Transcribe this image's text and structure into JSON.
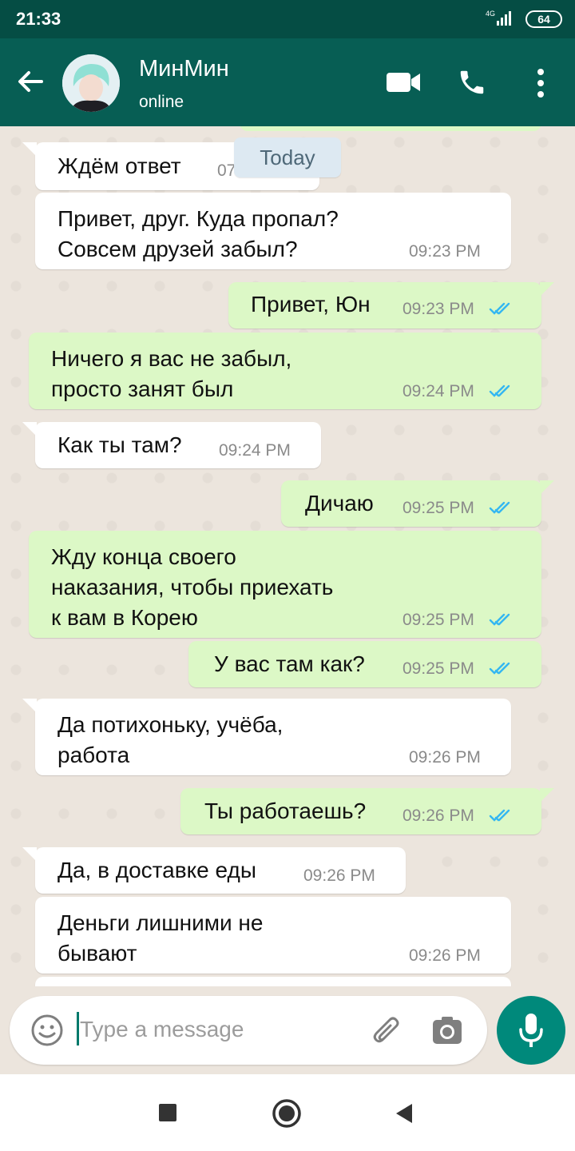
{
  "status_bar": {
    "time": "21:33",
    "network": "4G",
    "battery": "64"
  },
  "header": {
    "contact_name": "МинМин",
    "status": "online"
  },
  "date_divider": "Today",
  "messages": [
    {
      "dir": "in",
      "text": "Ждём ответ",
      "time": "07"
    },
    {
      "dir": "in",
      "text": "Привет, друг. Куда пропал?\nСовсем друзей забыл?",
      "time": "09:23 PM"
    },
    {
      "dir": "out",
      "text": "Привет, Юн",
      "time": "09:23 PM"
    },
    {
      "dir": "out",
      "text": "Ничего я вас не забыл,\nпросто занят был",
      "time": "09:24 PM"
    },
    {
      "dir": "in",
      "text": "Как ты там?",
      "time": "09:24 PM"
    },
    {
      "dir": "out",
      "text": "Дичаю",
      "time": "09:25 PM"
    },
    {
      "dir": "out",
      "text": "Жду конца своего\nнаказания, чтобы приехать\nк вам в Корею",
      "time": "09:25 PM"
    },
    {
      "dir": "out",
      "text": "У вас там как?",
      "time": "09:25 PM"
    },
    {
      "dir": "in",
      "text": "Да потихоньку, учёба,\nработа",
      "time": "09:26 PM"
    },
    {
      "dir": "out",
      "text": "Ты работаешь?",
      "time": "09:26 PM"
    },
    {
      "dir": "in",
      "text": "Да, в доставке еды",
      "time": "09:26 PM"
    },
    {
      "dir": "in",
      "text": "Деньги лишними не\nбывают",
      "time": "09:26 PM"
    }
  ],
  "composer": {
    "placeholder": "Type a message"
  },
  "colors": {
    "header": "#075e54",
    "incoming": "#ffffff",
    "outgoing": "#dcf8c6",
    "read_ticks": "#34b7f1",
    "fab": "#00897b"
  },
  "icons": [
    "back-arrow-icon",
    "video-call-icon",
    "phone-icon",
    "more-vert-icon",
    "emoji-icon",
    "attach-icon",
    "camera-icon",
    "mic-icon",
    "double-check-icon"
  ]
}
